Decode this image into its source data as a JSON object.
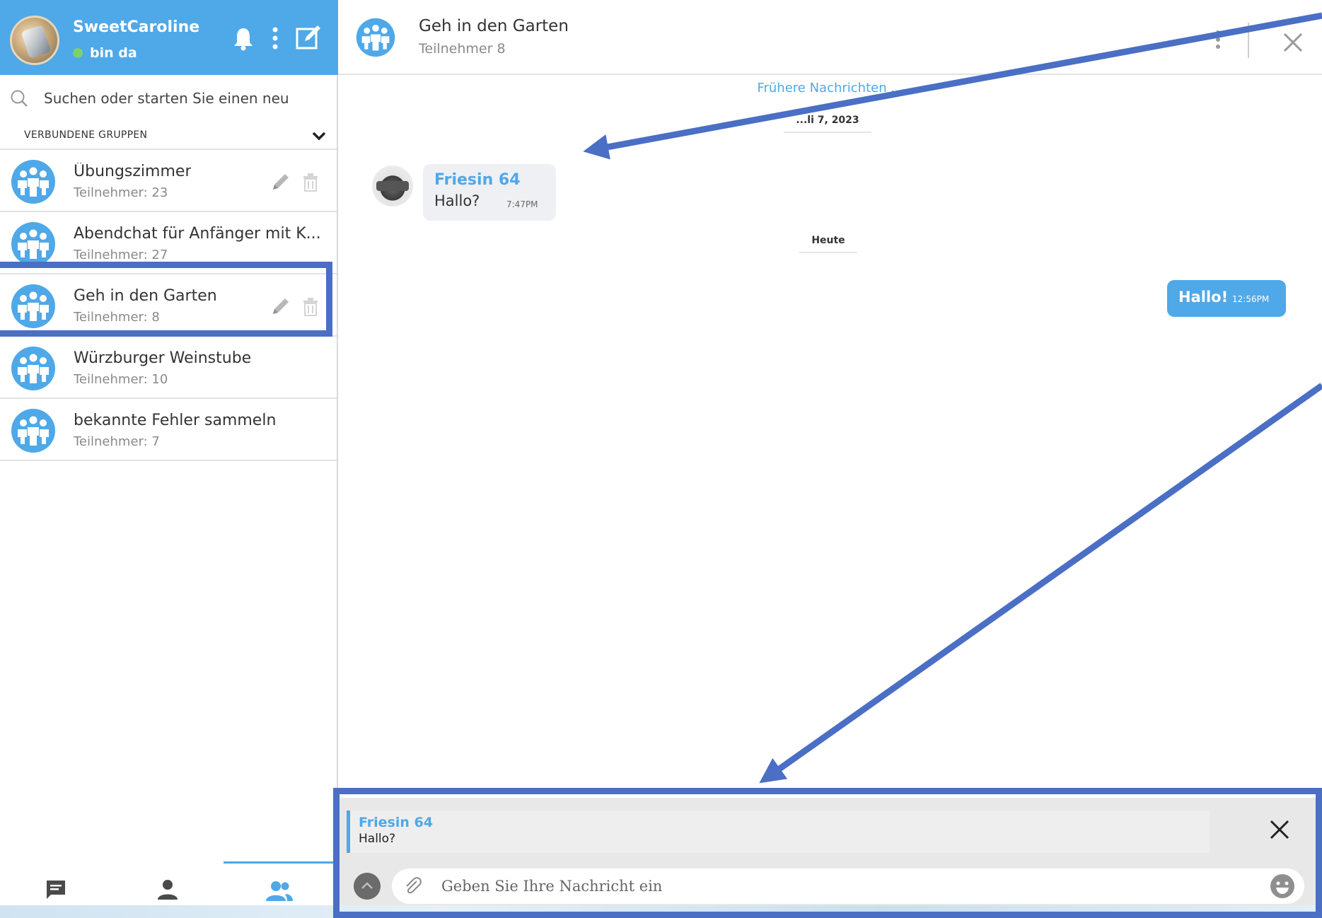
{
  "me": {
    "name": "SweetCaroline",
    "status": "bin da"
  },
  "search": {
    "placeholder": "Suchen oder starten Sie einen neu"
  },
  "groups_header": "VERBUNDENE GRUPPEN",
  "groups": [
    {
      "name": "Übungszimmer",
      "count": "Teilnehmer: 23"
    },
    {
      "name": "Abendchat für Anfänger mit K...",
      "count": "Teilnehmer: 27"
    },
    {
      "name": "Geh in den Garten",
      "count": "Teilnehmer: 8"
    },
    {
      "name": "Würzburger Weinstube",
      "count": "Teilnehmer: 10"
    },
    {
      "name": "bekannte Fehler sammeln",
      "count": "Teilnehmer: 7"
    }
  ],
  "chat": {
    "title": "Geh in den Garten",
    "subtitle": "Teilnehmer 8",
    "older_link": "Frühere Nachrichten ...",
    "date_1": "...li 7, 2023",
    "date_2": "Heute",
    "incoming": {
      "sender": "Friesin 64",
      "text": "Hallo?",
      "time": "7:47PM"
    },
    "outgoing": {
      "text": "Hallo!",
      "time": "12:56PM"
    }
  },
  "reply": {
    "sender": "Friesin 64",
    "text": "Hallo?"
  },
  "composer": {
    "placeholder": "Geben Sie Ihre Nachricht ein"
  },
  "colors": {
    "accent": "#4fa8e8",
    "annotation": "#4a6fc4"
  }
}
